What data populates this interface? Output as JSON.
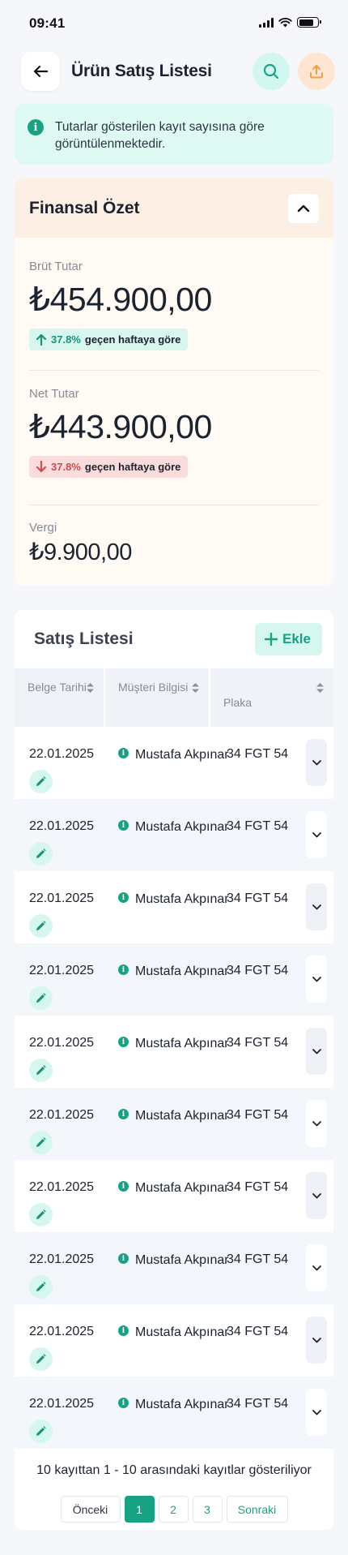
{
  "status_bar": {
    "time": "09:41"
  },
  "header": {
    "title": "Ürün Satış Listesi"
  },
  "info_banner": {
    "text": "Tutarlar gösterilen kayıt sayısına göre görüntülenmektedir."
  },
  "summary": {
    "title": "Finansal Özet",
    "gross": {
      "label": "Brüt Tutar",
      "value": "₺454.900,00",
      "delta_pct": "37.8%",
      "delta_text": "geçen haftaya göre",
      "direction": "up"
    },
    "net": {
      "label": "Net Tutar",
      "value": "₺443.900,00",
      "delta_pct": "37.8%",
      "delta_text": "geçen haftaya göre",
      "direction": "down"
    },
    "tax": {
      "label": "Vergi",
      "value": "₺9.900,00"
    }
  },
  "sales": {
    "title": "Satış Listesi",
    "add_label": "Ekle",
    "columns": [
      "Belge Tarihi",
      "Müşteri Bilgisi",
      "Plaka"
    ],
    "rows": [
      {
        "date": "22.01.2025",
        "customer": "Mustafa Akpınar",
        "plate": "34 FGT 54"
      },
      {
        "date": "22.01.2025",
        "customer": "Mustafa Akpınar",
        "plate": "34 FGT 54"
      },
      {
        "date": "22.01.2025",
        "customer": "Mustafa Akpınar",
        "plate": "34 FGT 54"
      },
      {
        "date": "22.01.2025",
        "customer": "Mustafa Akpınar",
        "plate": "34 FGT 54"
      },
      {
        "date": "22.01.2025",
        "customer": "Mustafa Akpınar",
        "plate": "34 FGT 54"
      },
      {
        "date": "22.01.2025",
        "customer": "Mustafa Akpınar",
        "plate": "34 FGT 54"
      },
      {
        "date": "22.01.2025",
        "customer": "Mustafa Akpınar",
        "plate": "34 FGT 54"
      },
      {
        "date": "22.01.2025",
        "customer": "Mustafa Akpınar",
        "plate": "34 FGT 54"
      },
      {
        "date": "22.01.2025",
        "customer": "Mustafa Akpınar",
        "plate": "34 FGT 54"
      },
      {
        "date": "22.01.2025",
        "customer": "Mustafa Akpınar",
        "plate": "34 FGT 54"
      }
    ],
    "pagination": {
      "info": "10 kayıttan 1 - 10 arasındaki kayıtlar gösteriliyor",
      "prev": "Önceki",
      "pages": [
        "1",
        "2",
        "3"
      ],
      "current": "1",
      "next": "Sonraki"
    }
  },
  "colors": {
    "accent": "#17a383",
    "accent_light": "#d6f7ef",
    "warning_light": "#fde5d2",
    "danger": "#d24b4b"
  }
}
